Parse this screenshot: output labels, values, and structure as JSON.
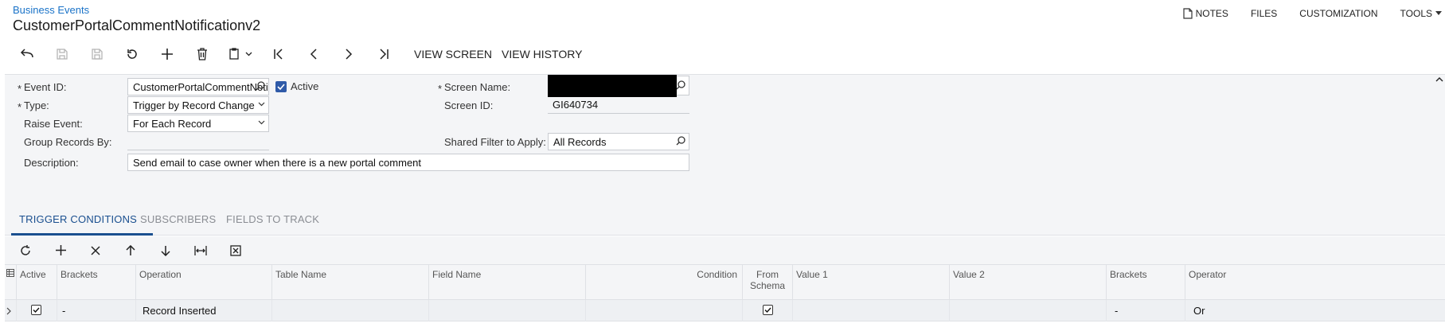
{
  "breadcrumb": "Business Events",
  "title": "CustomerPortalCommentNotificationv2",
  "top_actions": {
    "notes": "NOTES",
    "files": "FILES",
    "customization": "CUSTOMIZATION",
    "tools": "TOOLS"
  },
  "toolbar": {
    "view_screen": "VIEW SCREEN",
    "view_history": "VIEW HISTORY"
  },
  "form": {
    "event_id_label": "Event ID:",
    "event_id_value": "CustomerPortalCommentNoti",
    "active_label": "Active",
    "type_label": "Type:",
    "type_value": "Trigger by Record Change",
    "raise_event_label": "Raise Event:",
    "raise_event_value": "For Each Record",
    "group_records_label": "Group Records By:",
    "group_records_value": "",
    "description_label": "Description:",
    "description_value": "Send email to case owner when there is a new portal comment",
    "screen_name_label": "Screen Name:",
    "screen_id_label": "Screen ID:",
    "screen_id_value": "GI640734",
    "shared_filter_label": "Shared Filter to Apply:",
    "shared_filter_value": "All Records",
    "required_mark": "*"
  },
  "tabs": [
    {
      "label": "TRIGGER CONDITIONS",
      "active": true
    },
    {
      "label": "SUBSCRIBERS",
      "active": false
    },
    {
      "label": "FIELDS TO TRACK",
      "active": false
    }
  ],
  "grid": {
    "columns": {
      "active": "Active",
      "brackets_open": "Brackets",
      "operation": "Operation",
      "table_name": "Table Name",
      "field_name": "Field Name",
      "condition": "Condition",
      "from_schema": "From Schema",
      "value1": "Value 1",
      "value2": "Value 2",
      "brackets_close": "Brackets",
      "operator": "Operator"
    },
    "rows": [
      {
        "active": true,
        "brackets_open": "-",
        "operation": "Record Inserted",
        "table_name": "",
        "field_name": "",
        "condition": "",
        "from_schema": true,
        "value1": "",
        "value2": "",
        "brackets_close": "-",
        "operator": "Or"
      }
    ]
  },
  "colors": {
    "link": "#1a73c8",
    "accent": "#1a4f8f",
    "panel": "#f4f5f7"
  }
}
